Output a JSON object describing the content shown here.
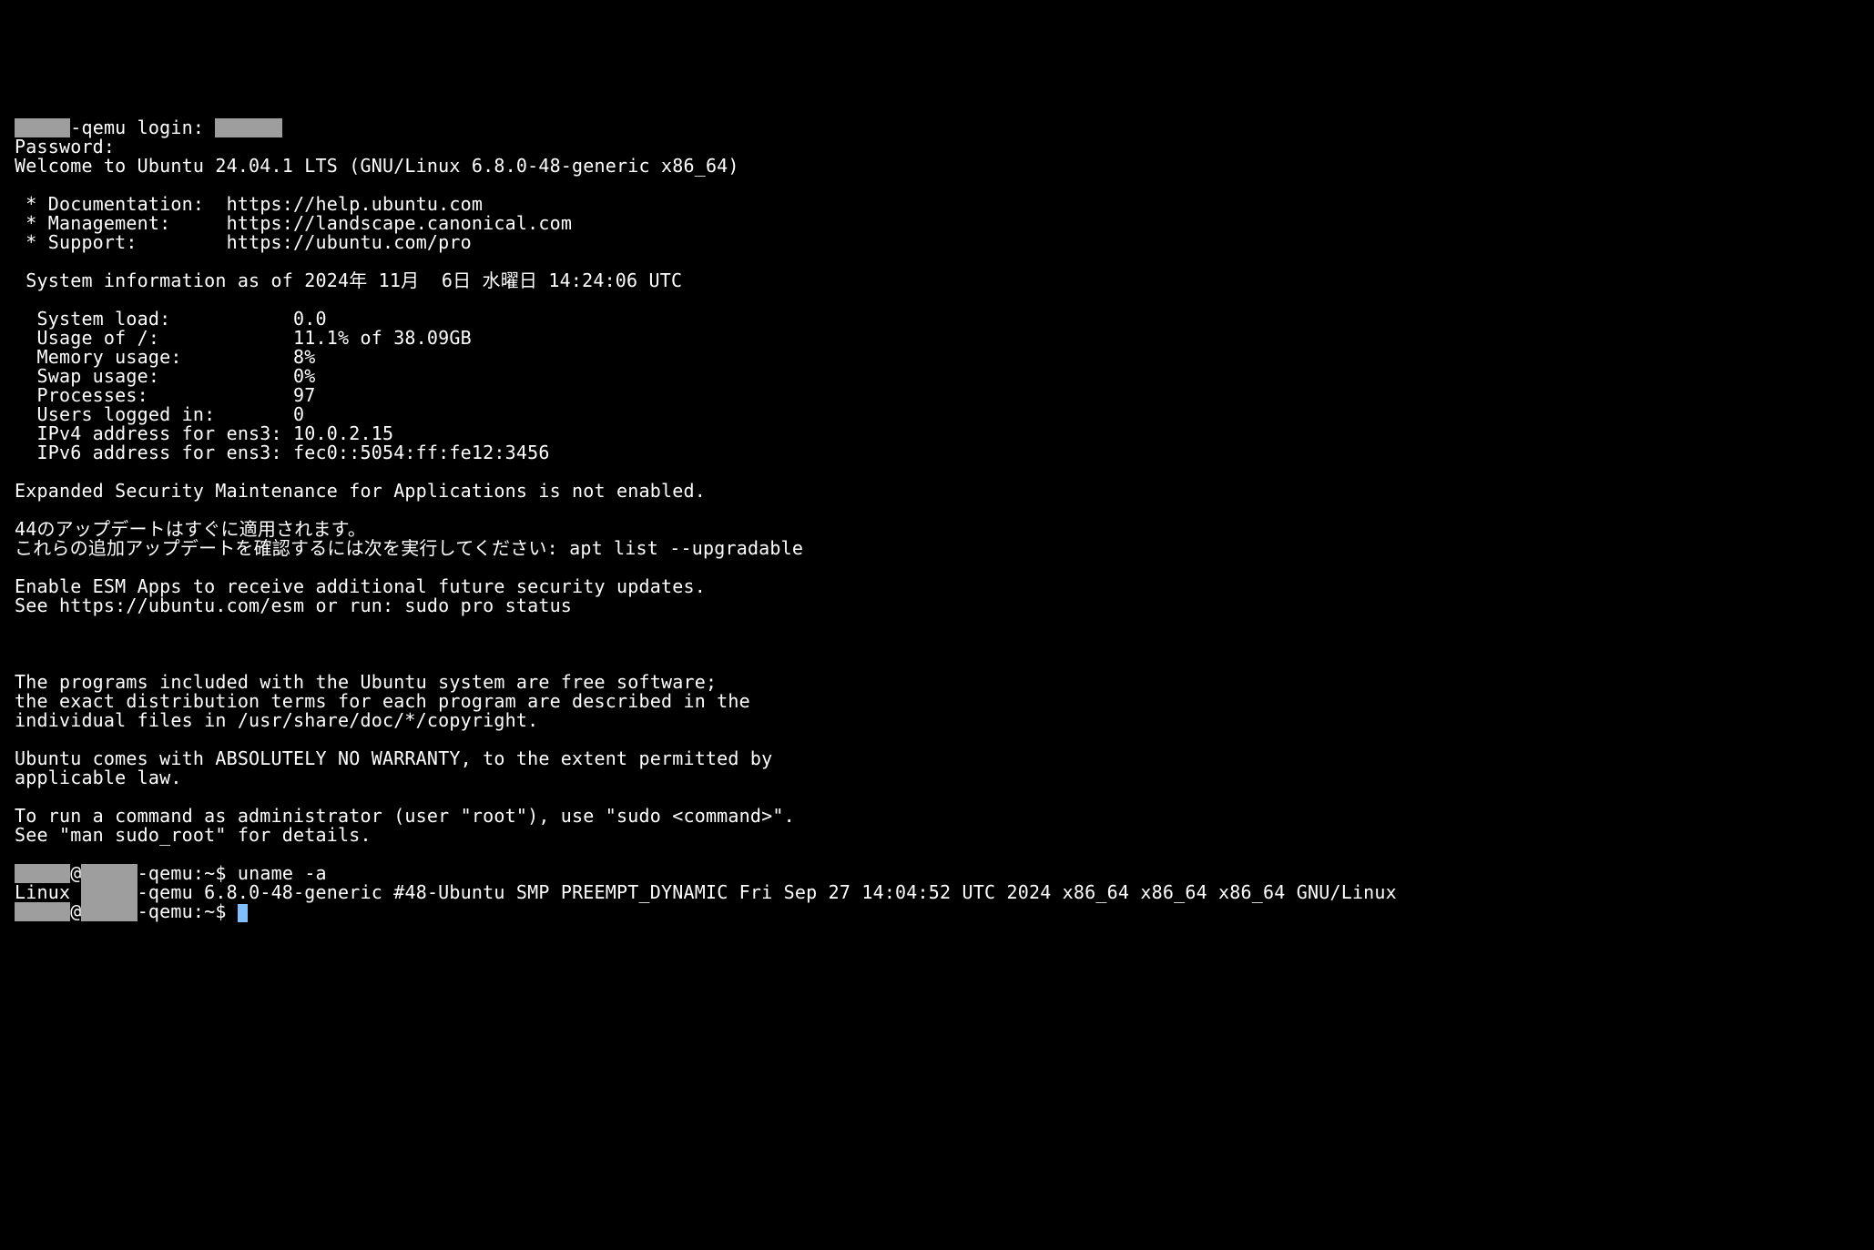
{
  "login_suffix": "-qemu login: ",
  "password_label": "Password:",
  "welcome": "Welcome to Ubuntu 24.04.1 LTS (GNU/Linux 6.8.0-48-generic x86_64)",
  "links": {
    "doc_label": " * Documentation:  ",
    "doc_url": "https://help.ubuntu.com",
    "mgmt_label": " * Management:     ",
    "mgmt_url": "https://landscape.canonical.com",
    "sup_label": " * Support:        ",
    "sup_url": "https://ubuntu.com/pro"
  },
  "sysinfo_header": " System information as of 2024年 11月  6日 水曜日 14:24:06 UTC",
  "sys": {
    "load": "  System load:           0.0",
    "usage": "  Usage of /:            11.1% of 38.09GB",
    "mem": "  Memory usage:          8%",
    "swap": "  Swap usage:            0%",
    "procs": "  Processes:             97",
    "users": "  Users logged in:       0",
    "ipv4": "  IPv4 address for ens3: 10.0.2.15",
    "ipv6": "  IPv6 address for ens3: fec0::5054:ff:fe12:3456"
  },
  "esm_not_enabled": "Expanded Security Maintenance for Applications is not enabled.",
  "updates_jp1": "44のアップデートはすぐに適用されます。",
  "updates_jp2": "これらの追加アップデートを確認するには次を実行してください: apt list --upgradable",
  "esm_apps1": "Enable ESM Apps to receive additional future security updates.",
  "esm_apps2": "See https://ubuntu.com/esm or run: sudo pro status",
  "legal1": "The programs included with the Ubuntu system are free software;",
  "legal2": "the exact distribution terms for each program are described in the",
  "legal3": "individual files in /usr/share/doc/*/copyright.",
  "warranty1": "Ubuntu comes with ABSOLUTELY NO WARRANTY, to the extent permitted by",
  "warranty2": "applicable law.",
  "sudo1": "To run a command as administrator (user \"root\"), use \"sudo <command>\".",
  "sudo2": "See \"man sudo_root\" for details.",
  "prompt": {
    "at": "@",
    "host_suffix": "-qemu",
    "tail": ":~$ ",
    "cmd": "uname -a"
  },
  "uname_out": {
    "pre": "Linux ",
    "post": "-qemu 6.8.0-48-generic #48-Ubuntu SMP PREEMPT_DYNAMIC Fri Sep 27 14:04:52 UTC 2024 x86_64 x86_64 x86_64 GNU/Linux"
  },
  "redacted_user_width": "5ch",
  "redacted_host_width": "5ch",
  "redacted_login_width": "6ch"
}
